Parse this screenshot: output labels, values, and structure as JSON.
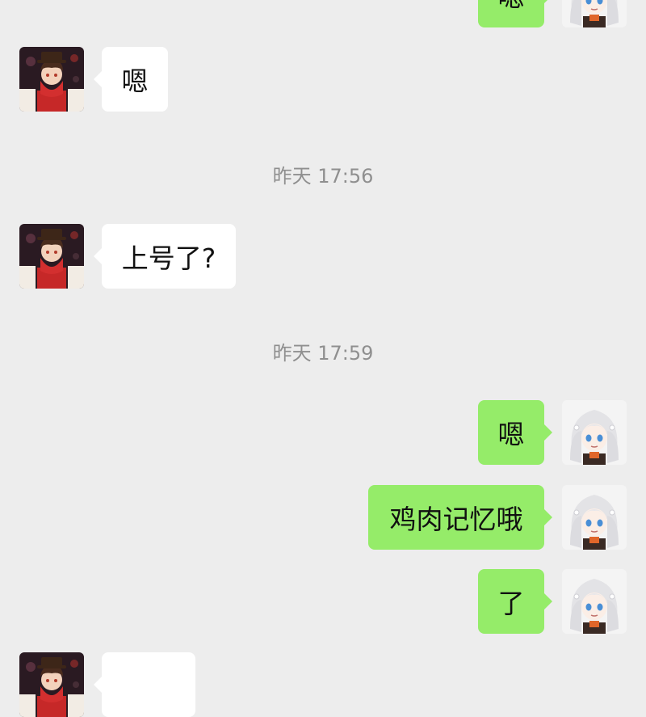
{
  "messages": [
    {
      "side": "out",
      "text": "嗯"
    },
    {
      "side": "in",
      "text": "嗯"
    },
    {
      "type": "time",
      "text": "昨天 17:56"
    },
    {
      "side": "in",
      "text": "上号了?"
    },
    {
      "type": "time",
      "text": "昨天 17:59"
    },
    {
      "side": "out",
      "text": "嗯"
    },
    {
      "side": "out",
      "text": "鸡肉记忆哦"
    },
    {
      "side": "out",
      "text": "了"
    },
    {
      "side": "in",
      "text": ""
    }
  ],
  "avatars": {
    "contact": "contact-avatar",
    "self": "self-avatar"
  },
  "colors": {
    "background": "#ededed",
    "outgoing_bubble": "#95ec69",
    "incoming_bubble": "#ffffff",
    "timestamp_text": "#8f8f8f"
  }
}
